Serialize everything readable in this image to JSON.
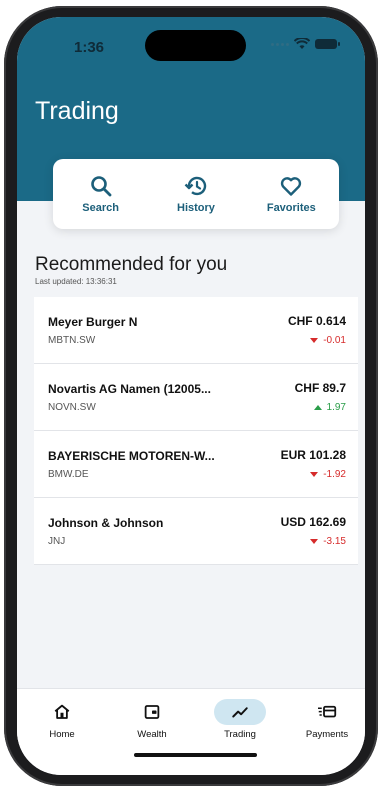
{
  "status_bar": {
    "time": "1:36"
  },
  "header": {
    "title": "Trading"
  },
  "quick_actions": [
    {
      "label": "Search",
      "icon": "search-icon"
    },
    {
      "label": "History",
      "icon": "history-icon"
    },
    {
      "label": "Favorites",
      "icon": "heart-icon"
    }
  ],
  "recommended": {
    "title": "Recommended for you",
    "last_updated": "Last updated: 13:36:31",
    "items": [
      {
        "name": "Meyer Burger N",
        "ticker": "MBTN.SW",
        "price": "CHF 0.614",
        "change": "-0.01",
        "direction": "down"
      },
      {
        "name": "Novartis AG Namen (12005...",
        "ticker": "NOVN.SW",
        "price": "CHF 89.7",
        "change": "1.97",
        "direction": "up"
      },
      {
        "name": "BAYERISCHE MOTOREN-W...",
        "ticker": "BMW.DE",
        "price": "EUR 101.28",
        "change": "-1.92",
        "direction": "down"
      },
      {
        "name": "Johnson & Johnson",
        "ticker": "JNJ",
        "price": "USD 162.69",
        "change": "-3.15",
        "direction": "down"
      }
    ]
  },
  "tabbar": {
    "active": "Trading",
    "items": [
      {
        "label": "Home",
        "icon": "home-icon"
      },
      {
        "label": "Wealth",
        "icon": "wallet-icon"
      },
      {
        "label": "Trading",
        "icon": "chart-line-icon"
      },
      {
        "label": "Payments",
        "icon": "payments-icon"
      }
    ]
  },
  "colors": {
    "brand": "#1b6a87",
    "accent_text": "#1c5f7a",
    "negative": "#d62b2b",
    "positive": "#2a9d49",
    "active_tab_bg": "#cfe6f1"
  }
}
